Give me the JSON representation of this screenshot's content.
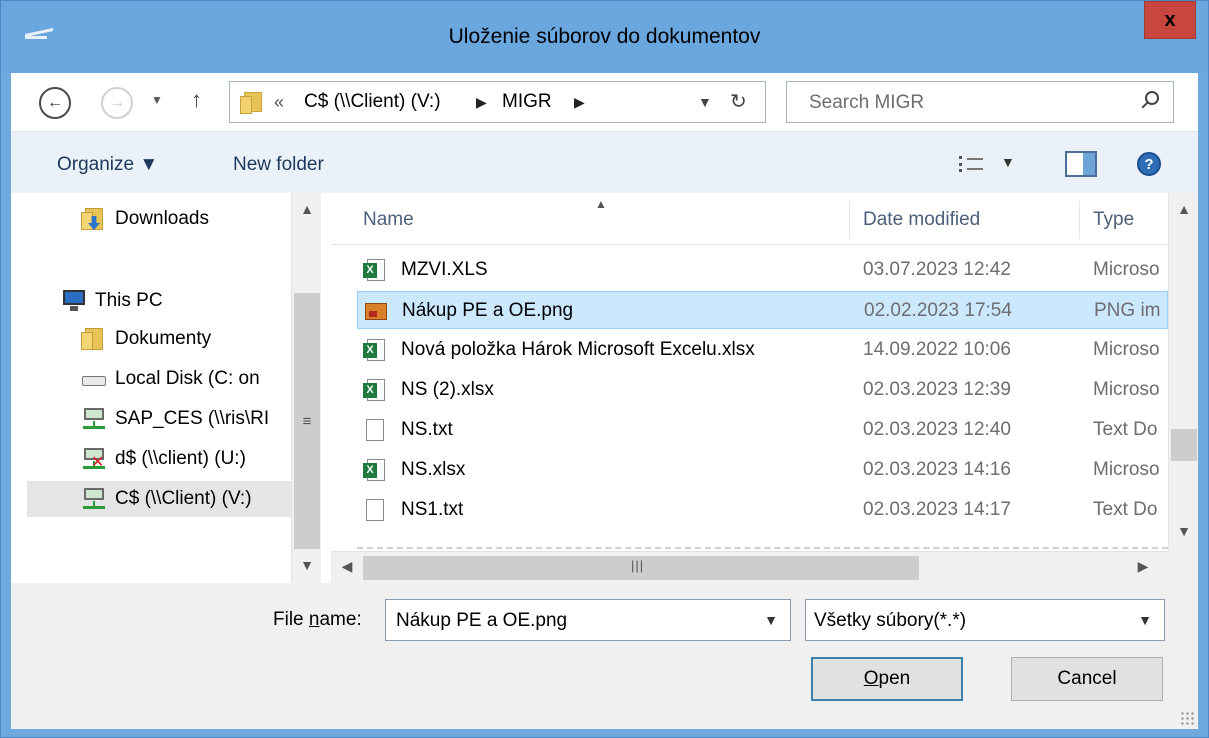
{
  "window": {
    "title": "Uloženie súborov do dokumentov",
    "close_label": "x"
  },
  "navbar": {
    "path_prefix": "«",
    "path_segments": [
      "C$ (\\\\Client) (V:)",
      "MIGR"
    ],
    "search_placeholder": "Search MIGR"
  },
  "toolbar": {
    "organize_label": "Organize ▼",
    "new_folder_label": "New folder",
    "help_label": "?"
  },
  "sidebar": {
    "items": [
      {
        "label": "Downloads",
        "icon": "downloads-folder-icon"
      },
      {
        "label": "This PC",
        "icon": "computer-icon"
      },
      {
        "label": "Dokumenty",
        "icon": "folder-icon"
      },
      {
        "label": "Local Disk (C: on",
        "icon": "disk-icon"
      },
      {
        "label": "SAP_CES (\\\\ris\\RI",
        "icon": "network-drive-icon"
      },
      {
        "label": "d$ (\\\\client) (U:)",
        "icon": "disconnected-drive-icon"
      },
      {
        "label": "C$ (\\\\Client) (V:)",
        "icon": "network-drive-icon",
        "selected": true
      }
    ]
  },
  "filelist": {
    "columns": [
      "Name",
      "Date modified",
      "Type"
    ],
    "rows": [
      {
        "name": "MZVI.XLS",
        "date": "03.07.2023 12:42",
        "type": "Microso",
        "icon": "excel-icon"
      },
      {
        "name": "Nákup PE a OE.png",
        "date": "02.02.2023 17:54",
        "type": "PNG im",
        "icon": "png-image-icon",
        "selected": true
      },
      {
        "name": "Nová položka Hárok Microsoft Excelu.xlsx",
        "date": "14.09.2022 10:06",
        "type": "Microso",
        "icon": "excel-icon"
      },
      {
        "name": "NS (2).xlsx",
        "date": "02.03.2023 12:39",
        "type": "Microso",
        "icon": "excel-icon"
      },
      {
        "name": "NS.txt",
        "date": "02.03.2023 12:40",
        "type": "Text Do",
        "icon": "text-file-icon"
      },
      {
        "name": "NS.xlsx",
        "date": "02.03.2023 14:16",
        "type": "Microso",
        "icon": "excel-icon"
      },
      {
        "name": "NS1.txt",
        "date": "02.03.2023 14:17",
        "type": "Text Do",
        "icon": "text-file-icon"
      }
    ]
  },
  "bottom": {
    "file_name_label_pre": "File ",
    "file_name_label_u": "n",
    "file_name_label_post": "ame:",
    "file_name_value": "Nákup PE a OE.png",
    "file_type_value": "Všetky súbory(*.*)",
    "open_u": "O",
    "open_rest": "pen",
    "cancel_label": "Cancel"
  },
  "colors": {
    "titlebar": "#6aa7df",
    "close": "#c7463d",
    "selection": "#cce8ff"
  }
}
